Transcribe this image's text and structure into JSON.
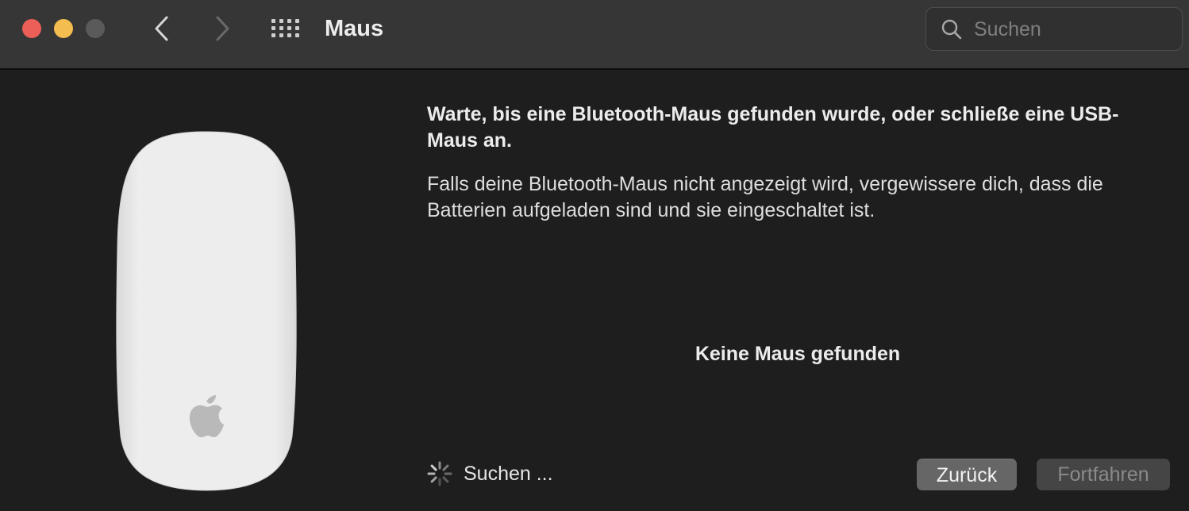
{
  "window": {
    "title": "Maus"
  },
  "search": {
    "placeholder": "Suchen"
  },
  "content": {
    "heading": "Warte, bis eine Bluetooth-Maus gefunden wurde, oder schließe eine USB-Maus an.",
    "body": "Falls deine Bluetooth-Maus nicht angezeigt wird, vergewissere dich, dass die Batterien aufgeladen sind und sie eingeschaltet ist.",
    "status": "Keine Maus gefunden"
  },
  "footer": {
    "searching_label": "Suchen ...",
    "back_label": "Zurück",
    "continue_label": "Fortfahren"
  },
  "icons": {
    "close": "close-icon",
    "minimize": "minimize-icon",
    "maximize": "maximize-icon",
    "back": "chevron-left-icon",
    "forward": "chevron-right-icon",
    "grid": "grid-icon",
    "search": "search-icon",
    "spinner": "spinner-icon",
    "apple_logo": "apple-logo-icon"
  },
  "colors": {
    "close": "#ec5f58",
    "minimize": "#f4bd4f",
    "maximize_disabled": "#5a5a5a",
    "background": "#1e1e1e",
    "titlebar": "#363636"
  }
}
